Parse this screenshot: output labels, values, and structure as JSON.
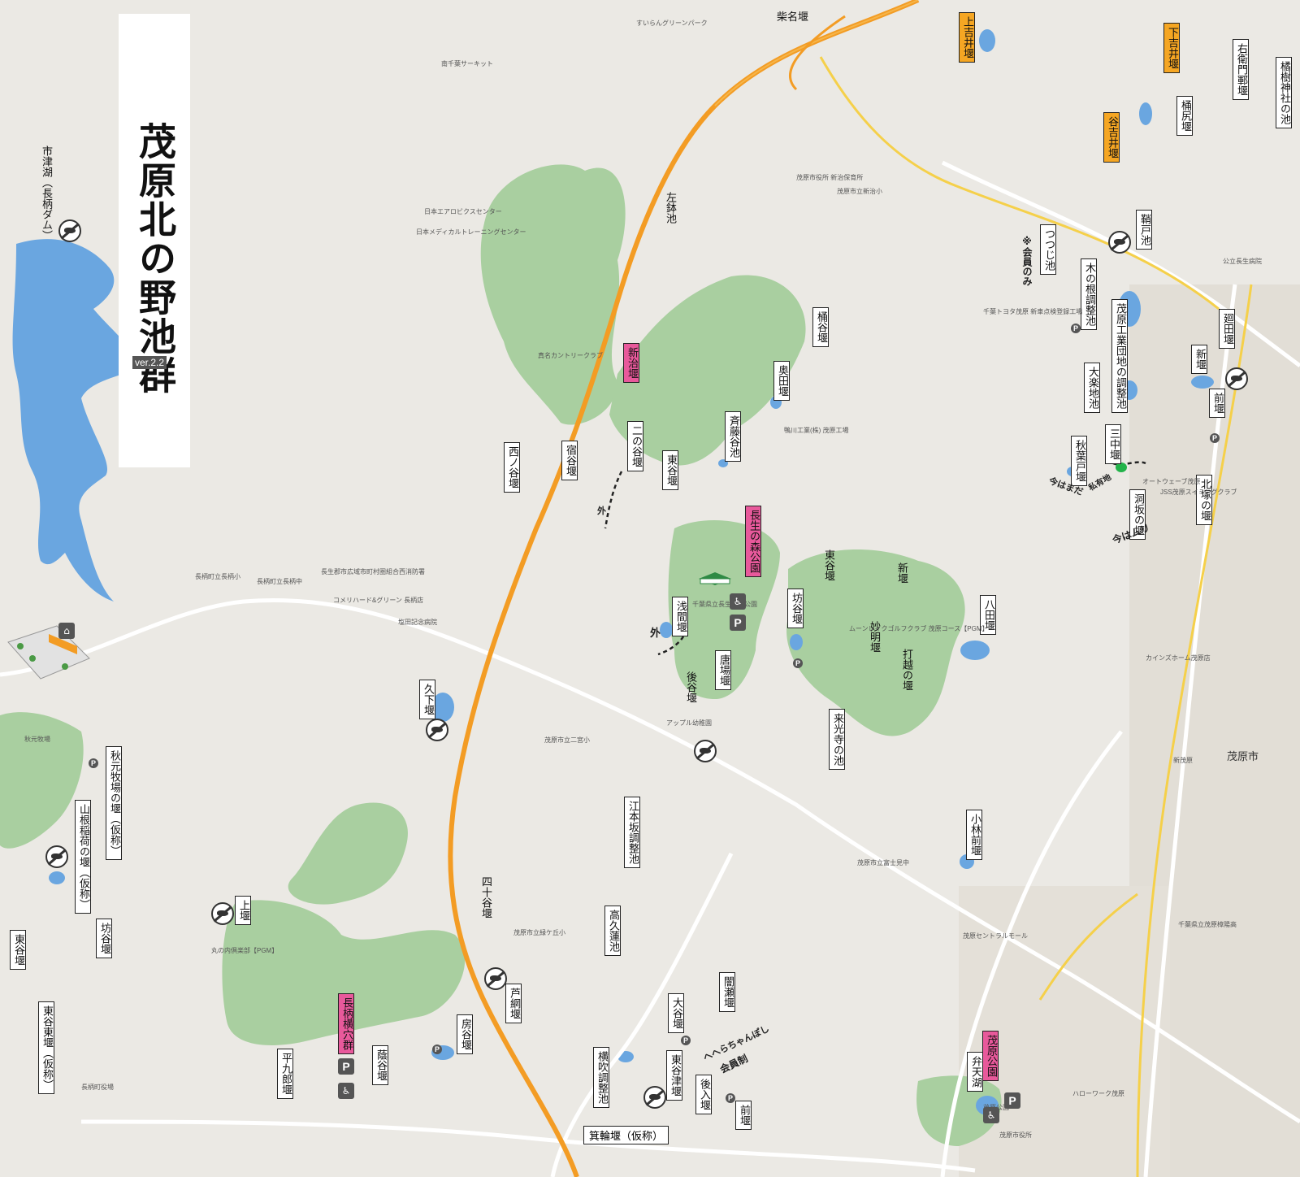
{
  "title": "茂原北の野池群",
  "version": "ver.2.2",
  "colors": {
    "land": "#ebe9e4",
    "water": "#6aa6e0",
    "forest": "#a9cfa0",
    "highway": "#f39c24",
    "road": "#ffffff",
    "pink_label": "#e8599b",
    "orange_label": "#f5a623"
  },
  "icons": {
    "no_fishing": "no-fishing-icon",
    "parking": "parking-icon",
    "toilet": "toilet-icon",
    "facility": "building-icon"
  },
  "pond_labels": [
    {
      "id": "ichitsuko",
      "text": "市津湖（長柄ダム）",
      "style": "plain"
    },
    {
      "id": "kamiyoshii",
      "text": "上吉井堰",
      "style": "orange"
    },
    {
      "id": "shimoyoshii",
      "text": "下吉井堰",
      "style": "orange"
    },
    {
      "id": "taniyoshii",
      "text": "谷吉井堰",
      "style": "orange"
    },
    {
      "id": "uemon",
      "text": "右衛門鄆堰",
      "style": "white"
    },
    {
      "id": "tachibana",
      "text": "橘樹神社の池",
      "style": "white"
    },
    {
      "id": "okejiri",
      "text": "桶尻堰",
      "style": "white"
    },
    {
      "id": "hagido",
      "text": "鞘戸池",
      "style": "white"
    },
    {
      "id": "tsutsuji",
      "text": "つつじ池",
      "style": "white"
    },
    {
      "id": "kinone",
      "text": "木の根調整池",
      "style": "white"
    },
    {
      "id": "mobarakogyo",
      "text": "茂原工業団地の調整池",
      "style": "white"
    },
    {
      "id": "sodada",
      "text": "廻田堰",
      "style": "white"
    },
    {
      "id": "shinzeki",
      "text": "新堰",
      "style": "white"
    },
    {
      "id": "maezeki",
      "text": "前堰",
      "style": "white"
    },
    {
      "id": "dairaku",
      "text": "大楽地池",
      "style": "white"
    },
    {
      "id": "mitsunaka",
      "text": "三中堰",
      "style": "white"
    },
    {
      "id": "akibado",
      "text": "秋葉戸堰",
      "style": "white"
    },
    {
      "id": "horasaka",
      "text": "洞坂の堰",
      "style": "white"
    },
    {
      "id": "kitatsuka",
      "text": "北塚の堰",
      "style": "white"
    },
    {
      "id": "hachida",
      "text": "八田堰",
      "style": "white"
    },
    {
      "id": "shinji",
      "text": "新治堰",
      "style": "pink"
    },
    {
      "id": "okeya",
      "text": "桶谷堰",
      "style": "white"
    },
    {
      "id": "okuda",
      "text": "奥田堰",
      "style": "white"
    },
    {
      "id": "saitoya",
      "text": "斉藤谷池",
      "style": "white"
    },
    {
      "id": "nishinoya",
      "text": "西ノ谷堰",
      "style": "white"
    },
    {
      "id": "shukuya",
      "text": "宿谷堰",
      "style": "white"
    },
    {
      "id": "ninoya",
      "text": "二の谷堰",
      "style": "white"
    },
    {
      "id": "higashiya",
      "text": "東谷堰",
      "style": "white"
    },
    {
      "id": "chosei",
      "text": "長生の森公園",
      "style": "pink"
    },
    {
      "id": "asama",
      "text": "浅間堰",
      "style": "white"
    },
    {
      "id": "bouya",
      "text": "坊谷堰",
      "style": "white"
    },
    {
      "id": "karaba",
      "text": "唐場堰",
      "style": "white"
    },
    {
      "id": "kugeshita",
      "text": "久下堰",
      "style": "white"
    },
    {
      "id": "kokoji",
      "text": "来光寺の池",
      "style": "white"
    },
    {
      "id": "akimoto",
      "text": "秋元牧場の堰（仮称）",
      "style": "white"
    },
    {
      "id": "yamane",
      "text": "山根稲荷の堰（仮称）",
      "style": "white"
    },
    {
      "id": "kamizeki",
      "text": "上堰",
      "style": "white"
    },
    {
      "id": "bouya2",
      "text": "坊谷堰",
      "style": "white"
    },
    {
      "id": "higashiya2",
      "text": "東谷堰",
      "style": "white"
    },
    {
      "id": "higashiyahigashi",
      "text": "東谷東堰（仮称）",
      "style": "white"
    },
    {
      "id": "emotozaka",
      "text": "江本坂調整池",
      "style": "white"
    },
    {
      "id": "kobayashimae",
      "text": "小林前堰",
      "style": "white"
    },
    {
      "id": "takakuhasu",
      "text": "高久蓮池",
      "style": "white"
    },
    {
      "id": "ashiami",
      "text": "芦網堰",
      "style": "white"
    },
    {
      "id": "nagarayoko",
      "text": "長柄横穴群",
      "style": "pink"
    },
    {
      "id": "fusaya",
      "text": "房谷堰",
      "style": "white"
    },
    {
      "id": "heikuro",
      "text": "平九郎堰",
      "style": "white"
    },
    {
      "id": "kageya",
      "text": "蔭谷堰",
      "style": "white"
    },
    {
      "id": "yokobuki",
      "text": "横吹調整池",
      "style": "white"
    },
    {
      "id": "oya",
      "text": "大谷堰",
      "style": "white"
    },
    {
      "id": "higashiyatsu",
      "text": "東谷津堰",
      "style": "white"
    },
    {
      "id": "ushiroiri",
      "text": "後入堰",
      "style": "white"
    },
    {
      "id": "mae2",
      "text": "前堰",
      "style": "white"
    },
    {
      "id": "kurase",
      "text": "闇瀬堰",
      "style": "white"
    },
    {
      "id": "mobarapark",
      "text": "茂原公園",
      "style": "pink"
    },
    {
      "id": "bentenko",
      "text": "弁天湖",
      "style": "white"
    }
  ],
  "plain_text": [
    {
      "id": "sainazeki",
      "text": "柴名堰"
    },
    {
      "id": "hidariike",
      "text": "左鉢池"
    },
    {
      "id": "higashiya3",
      "text": "東谷堰"
    },
    {
      "id": "shinzeki2",
      "text": "新堰"
    },
    {
      "id": "myoumyou",
      "text": "妙明堰"
    },
    {
      "id": "uchikoshi",
      "text": "打越の堰"
    },
    {
      "id": "ushiroya",
      "text": "後谷堰"
    },
    {
      "id": "shijuya",
      "text": "四十谷堰"
    }
  ],
  "bottom_label": "箕輪堰（仮称）",
  "annotations": {
    "members_only": "※会員のみ",
    "outside": "外",
    "outside2": "外",
    "inside": "今はまだ",
    "hebi": "へへらちゃんぽし",
    "kaiin": "会員制",
    "memo1": "今はムリ",
    "memo2": "私有地"
  },
  "places": [
    {
      "id": "p1",
      "text": "すいらんグリーンパーク"
    },
    {
      "id": "p2",
      "text": "南千葉サーキット"
    },
    {
      "id": "p3",
      "text": "日本エアロビクスセンター"
    },
    {
      "id": "p4",
      "text": "日本メディカルトレーニングセンター"
    },
    {
      "id": "p5",
      "text": "真名カントリークラブ"
    },
    {
      "id": "p6",
      "text": "茂原市役所 新治保育所"
    },
    {
      "id": "p7",
      "text": "茂原市立新治小"
    },
    {
      "id": "p8",
      "text": "千葉トヨタ茂原 新車点検登録工場"
    },
    {
      "id": "p9",
      "text": "鴨川工業(株) 茂原工場"
    },
    {
      "id": "p10",
      "text": "ムーンレイクゴルフクラブ 茂原コース【PGM】"
    },
    {
      "id": "p11",
      "text": "千葉県立長生の森公園"
    },
    {
      "id": "p12",
      "text": "アップル幼稚園"
    },
    {
      "id": "p13",
      "text": "茂原市立二宮小"
    },
    {
      "id": "p14",
      "text": "長生郡市広域市町村圏組合西消防署"
    },
    {
      "id": "p15",
      "text": "コメリハード&グリーン 長柄店"
    },
    {
      "id": "p16",
      "text": "塩田記念病院"
    },
    {
      "id": "p17",
      "text": "長柄町立長柄中"
    },
    {
      "id": "p18",
      "text": "長柄町立長柄小"
    },
    {
      "id": "p19",
      "text": "丸の内倶楽部【PGM】"
    },
    {
      "id": "p20",
      "text": "茂原市立緑ケ丘小"
    },
    {
      "id": "p21",
      "text": "茂原セントラルモール"
    },
    {
      "id": "p22",
      "text": "茂原市"
    },
    {
      "id": "p23",
      "text": "茂原公園"
    },
    {
      "id": "p24",
      "text": "茂原市役所"
    },
    {
      "id": "p25",
      "text": "ハローワーク茂原"
    },
    {
      "id": "p26",
      "text": "千葉県立茂原樟陽高"
    },
    {
      "id": "p27",
      "text": "オートウェーブ茂原"
    },
    {
      "id": "p28",
      "text": "JSS茂原スイミングクラブ"
    },
    {
      "id": "p29",
      "text": "カインズホーム茂原店"
    },
    {
      "id": "p30",
      "text": "茂原市立富士見中"
    },
    {
      "id": "p31",
      "text": "秋元牧場"
    },
    {
      "id": "p32",
      "text": "長柄町役場"
    },
    {
      "id": "p33",
      "text": "公立長生病院"
    },
    {
      "id": "p34",
      "text": "新茂原"
    }
  ]
}
